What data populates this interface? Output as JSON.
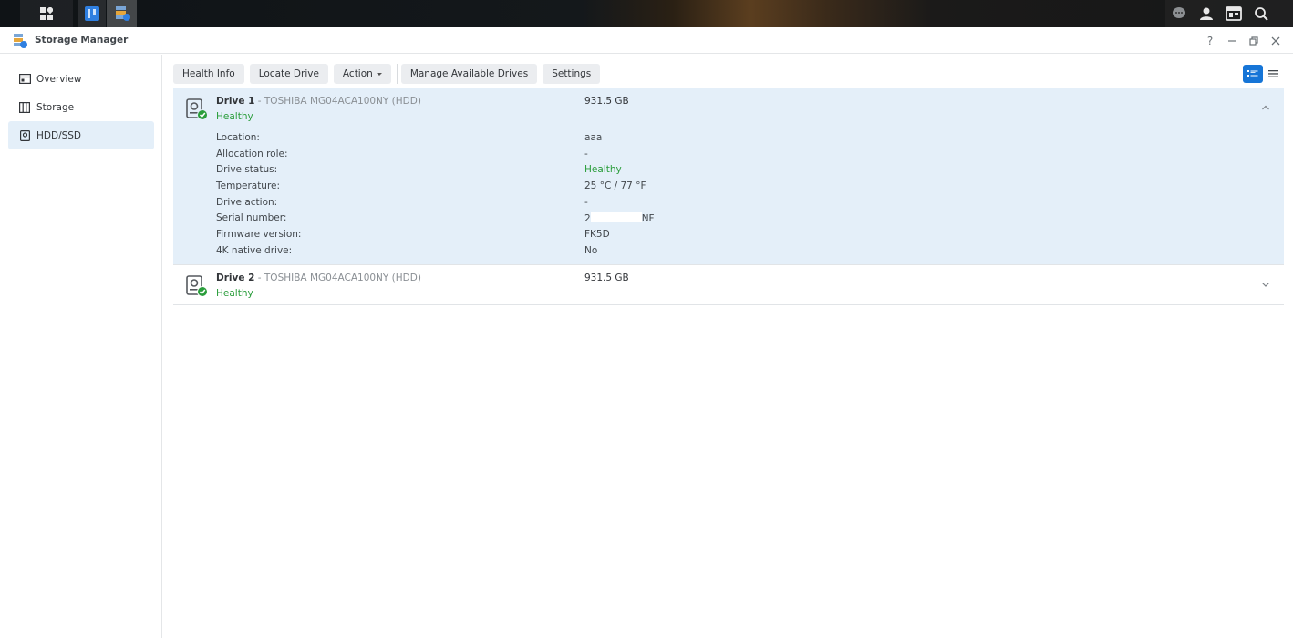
{
  "window": {
    "title": "Storage Manager"
  },
  "sidebar": {
    "items": [
      {
        "label": "Overview",
        "icon": "overview-icon",
        "active": false
      },
      {
        "label": "Storage",
        "icon": "storage-icon",
        "active": false
      },
      {
        "label": "HDD/SSD",
        "icon": "hdd-icon",
        "active": true
      }
    ]
  },
  "toolbar": {
    "health_info": "Health Info",
    "locate_drive": "Locate Drive",
    "action": "Action",
    "manage_available_drives": "Manage Available Drives",
    "settings": "Settings"
  },
  "drives": [
    {
      "name": "Drive 1",
      "model": " - TOSHIBA MG04ACA100NY (HDD)",
      "health": "Healthy",
      "size": "931.5 GB",
      "expanded": true,
      "details": [
        {
          "label": "Location:",
          "value": "aaa"
        },
        {
          "label": "Allocation role:",
          "value": "-"
        },
        {
          "label": "Drive status:",
          "value": "Healthy"
        },
        {
          "label": "Temperature:",
          "value": "25 °C / 77 °F"
        },
        {
          "label": "Drive action:",
          "value": "-"
        },
        {
          "label": "Serial number:",
          "value_prefix": "2",
          "value_suffix": "NF"
        },
        {
          "label": "Firmware version:",
          "value": "FK5D"
        },
        {
          "label": "4K native drive:",
          "value": "No"
        }
      ]
    },
    {
      "name": "Drive 2",
      "model": " - TOSHIBA MG04ACA100NY (HDD)",
      "health": "Healthy",
      "size": "931.5 GB",
      "expanded": false
    }
  ],
  "colors": {
    "accent": "#1675d7",
    "healthy": "#2a9d3b",
    "selected_bg": "#e4eff9"
  }
}
